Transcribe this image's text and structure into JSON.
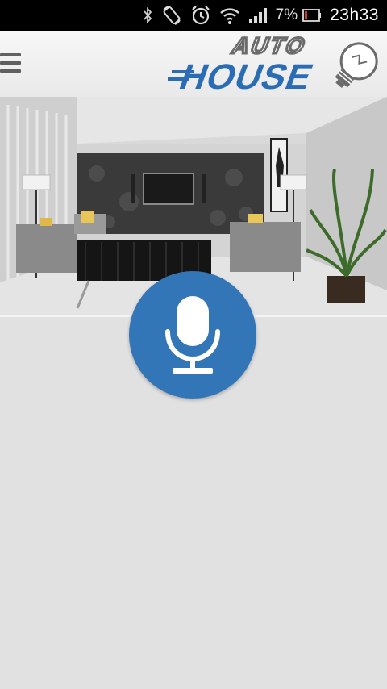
{
  "status_bar": {
    "icons": [
      "bluetooth-icon",
      "screen-rotate-icon",
      "alarm-icon",
      "wifi-icon",
      "cell-signal-icon"
    ],
    "battery_percent": "7%",
    "battery_icon": "battery-low-icon",
    "time": "23h33"
  },
  "header": {
    "menu_icon": "hamburger-menu-icon",
    "logo": {
      "line1": "AUTO",
      "line2": "HOUSE",
      "icon": "light-bulb-icon"
    },
    "colors": {
      "logo_blue": "#2a6db5",
      "logo_gray": "#6b6b6b"
    }
  },
  "hero": {
    "image": "living-room-photo"
  },
  "mic_button": {
    "icon": "microphone-icon",
    "color": "#3376b8"
  },
  "colors": {
    "background": "#e1e1e1",
    "status_bar": "#000000"
  }
}
